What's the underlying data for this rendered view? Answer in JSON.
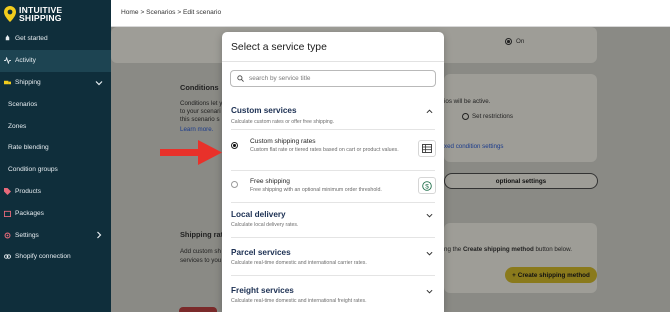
{
  "app": {
    "logo_line1": "INTUITIVE",
    "logo_line2": "SHIPPING"
  },
  "sidebar": {
    "items": [
      {
        "label": "Get started"
      },
      {
        "label": "Activity"
      },
      {
        "label": "Shipping"
      },
      {
        "label": "Scenarios"
      },
      {
        "label": "Zones"
      },
      {
        "label": "Rate blending"
      },
      {
        "label": "Condition groups"
      },
      {
        "label": "Products"
      },
      {
        "label": "Packages"
      },
      {
        "label": "Settings"
      },
      {
        "label": "Shopify connection"
      }
    ]
  },
  "breadcrumb": {
    "home": "Home",
    "scenarios": "Scenarios",
    "current": "Edit scenario"
  },
  "background": {
    "on_label": "On",
    "conditions_title": "Conditions",
    "conditions_text_1": "Conditions let y",
    "conditions_text_2": "to your scenari",
    "conditions_text_3": "this scenario s",
    "learn_more": "Learn more.",
    "will_be_active": "ios will be active.",
    "set_restrictions": "Set restrictions",
    "xed_condition_settings": "xed condition settings",
    "optional_settings": "optional settings",
    "shipping_rates_title": "Shipping rat",
    "shipping_rates_text_1": "Add custom sh",
    "shipping_rates_text_2": "services to you",
    "create_hint_prefix": "ng the ",
    "create_hint_bold": "Create shipping method",
    "create_hint_suffix": " button below.",
    "create_button": "Create shipping method",
    "create_button_plus": "+"
  },
  "modal": {
    "title": "Select a service type",
    "search_placeholder": "search by service title",
    "sections": [
      {
        "title": "Custom services",
        "desc": "Calculate custom rates or offer free shipping.",
        "options": [
          {
            "title": "Custom shipping rates",
            "desc": "Custom flat rate or tiered rates based on cart or product values.",
            "selected": true,
            "icon": "table-icon"
          },
          {
            "title": "Free shipping",
            "desc": "Free shipping with an optional minimum order threshold.",
            "selected": false,
            "icon": "dollar-circle-icon"
          }
        ]
      },
      {
        "title": "Local delivery",
        "desc": "Calculate local delivery rates."
      },
      {
        "title": "Parcel services",
        "desc": "Calculate real-time domestic and international carrier rates."
      },
      {
        "title": "Freight services",
        "desc": "Calculate real-time domestic and international freight rates."
      }
    ]
  },
  "colors": {
    "sidebar_bg": "#0f2e3b",
    "accent_yellow": "#f2cd1d",
    "arrow_red": "#e8312a",
    "section_title": "#1b2f52"
  }
}
